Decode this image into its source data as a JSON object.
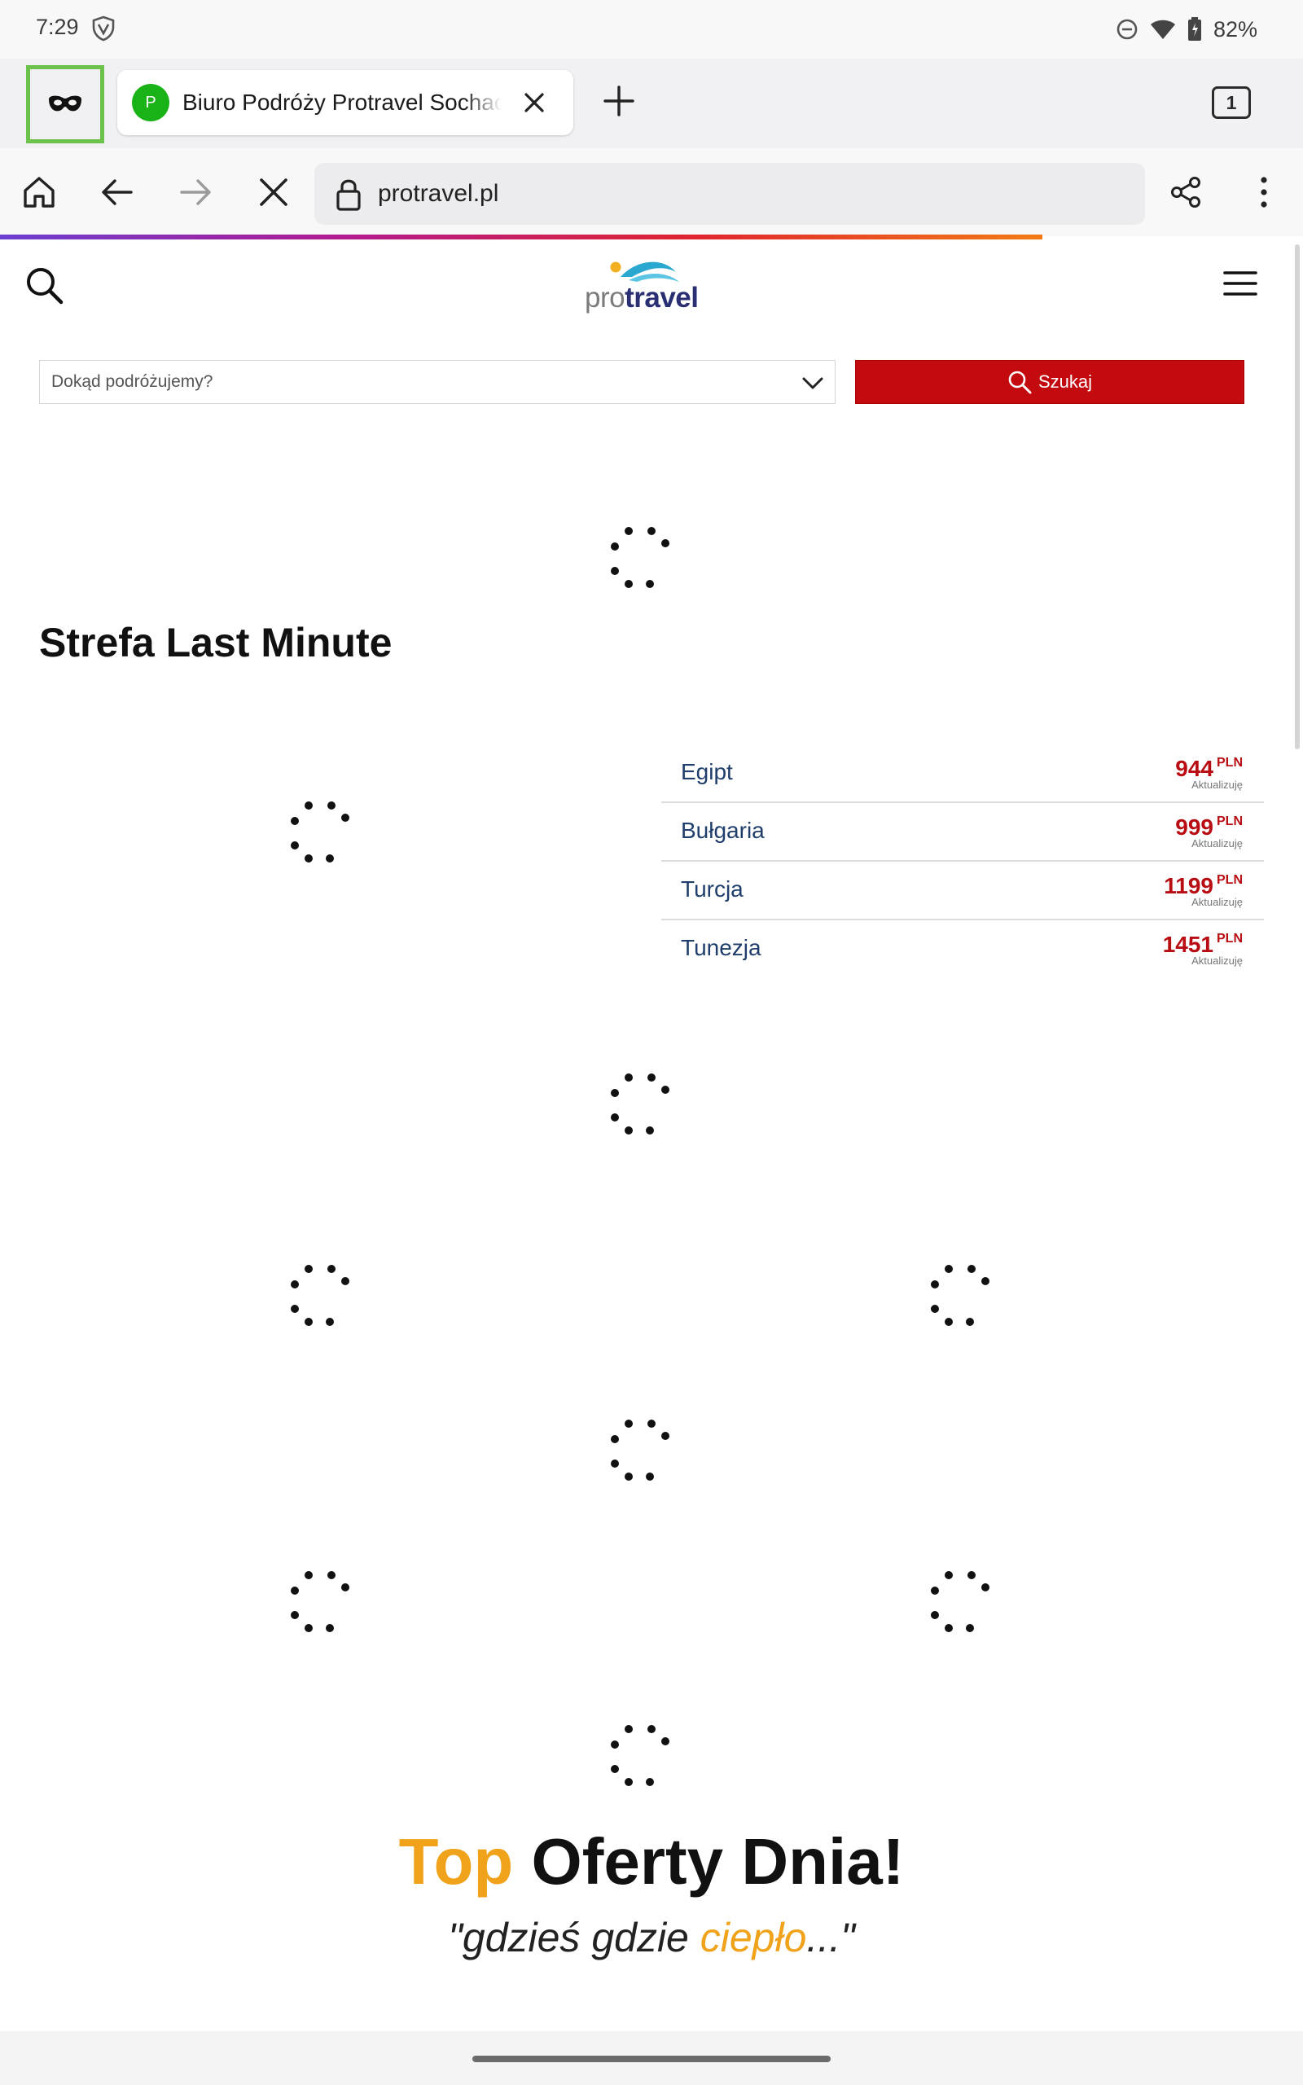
{
  "status_bar": {
    "time": "7:29",
    "battery": "82%",
    "icons": [
      "vpn-shield-icon",
      "do-not-disturb-icon",
      "wifi-icon",
      "battery-icon"
    ]
  },
  "browser": {
    "private_mode_icon": "mask-icon",
    "tab": {
      "favicon_letter": "P",
      "favicon_color": "#19b318",
      "title": "Biuro Podróży Protravel Sochaczew"
    },
    "tab_count": "1",
    "url": "protravel.pl",
    "progress_colors": [
      "#6b3fd1",
      "#b21a8f",
      "#e0242f",
      "#f27b16"
    ],
    "load_progress": 0.8
  },
  "site": {
    "logo": {
      "pro": "pro",
      "travel": "travel"
    },
    "search": {
      "placeholder": "Dokąd podróżujemy?",
      "button_label": "Szukaj"
    },
    "last_minute": {
      "title": "Strefa Last Minute",
      "items": [
        {
          "country": "Egipt",
          "price": "944",
          "currency": "PLN",
          "note": "Aktualizuję"
        },
        {
          "country": "Bułgaria",
          "price": "999",
          "currency": "PLN",
          "note": "Aktualizuję"
        },
        {
          "country": "Turcja",
          "price": "1199",
          "currency": "PLN",
          "note": "Aktualizuję"
        },
        {
          "country": "Tunezja",
          "price": "1451",
          "currency": "PLN",
          "note": "Aktualizuję"
        }
      ]
    },
    "top_offers": {
      "title_accent": "Top",
      "title_rest": " Oferty Dnia!",
      "subtitle_open": "\"gdzieś gdzie ",
      "subtitle_accent": "ciepło",
      "subtitle_close": "...\""
    },
    "colors": {
      "brand_red": "#c30a0f",
      "accent_orange": "#f0a21a",
      "logo_navy": "#2a2f74",
      "logo_teal": "#2ba8d0"
    }
  }
}
